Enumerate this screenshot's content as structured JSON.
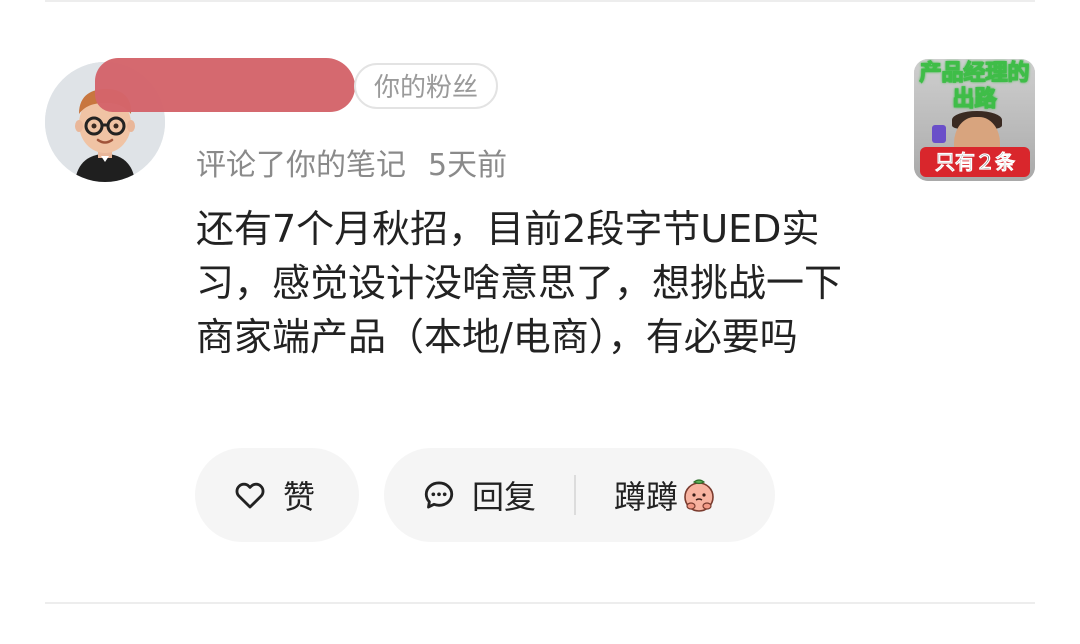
{
  "notification": {
    "fan_badge": "你的粉丝",
    "action": "评论了你的笔记",
    "time": "5天前",
    "content": "还有7个月秋招，目前2段字节UED实习，感觉设计没啥意思了，想挑战一下商家端产品（本地/电商），有必要吗",
    "actions": {
      "like_label": "赞",
      "reply_label": "回复",
      "sticker_label": "蹲蹲"
    },
    "icons": {
      "like": "heart-outline-icon",
      "reply": "chat-bubble-icon",
      "sticker": "peach-sticker-icon"
    },
    "thumbnail": {
      "title": "产品经理的出路",
      "footer": "只有２条"
    }
  },
  "colors": {
    "redaction": "#d4646a",
    "pill_bg": "#f5f5f5",
    "meta_text": "#8a8a8a",
    "badge_text": "#9a9a9a",
    "thumb_outline": "#3fbd48",
    "thumb_footer": "#d9262c"
  }
}
